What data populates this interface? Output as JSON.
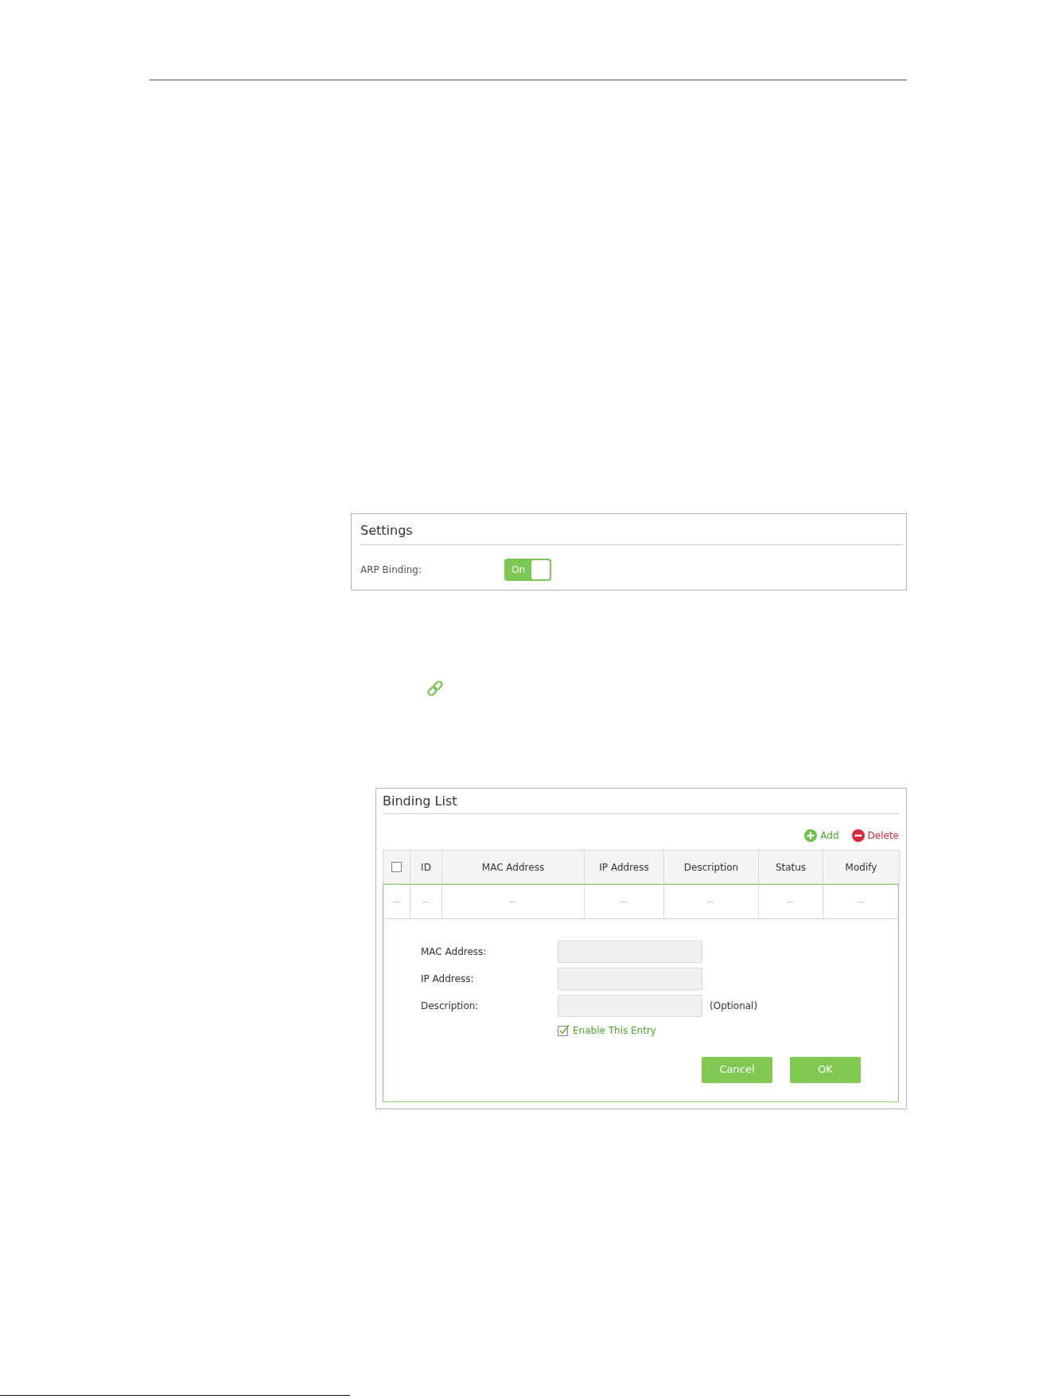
{
  "settings": {
    "title": "Settings",
    "arp_binding": {
      "label": "ARP Binding:",
      "toggle": {
        "text": "On",
        "on": true
      }
    }
  },
  "binding_list": {
    "title": "Binding List",
    "toolbar": [
      {
        "kind": "add",
        "label": "Add"
      },
      {
        "kind": "delete",
        "label": "Delete"
      }
    ],
    "table": {
      "columns": [
        {
          "kind": "checkbox",
          "checked": false
        },
        {
          "kind": "text",
          "label": "ID"
        },
        {
          "kind": "text",
          "label": "MAC Address"
        },
        {
          "kind": "text",
          "label": "IP Address"
        },
        {
          "kind": "text",
          "label": "Description"
        },
        {
          "kind": "text",
          "label": "Status"
        },
        {
          "kind": "text",
          "label": "Modify"
        }
      ],
      "rows": [
        {
          "cells": [
            "--",
            "--",
            "--",
            "--",
            "--",
            "--",
            "--"
          ]
        }
      ]
    },
    "form": {
      "fields": [
        {
          "label": "MAC Address:"
        },
        {
          "label": "IP Address:"
        },
        {
          "label": "Description:",
          "note": "(Optional)"
        }
      ],
      "enable_entry": {
        "label": "Enable This Entry",
        "checked": true
      },
      "buttons": [
        {
          "label": "Cancel"
        },
        {
          "label": "OK"
        }
      ]
    }
  }
}
